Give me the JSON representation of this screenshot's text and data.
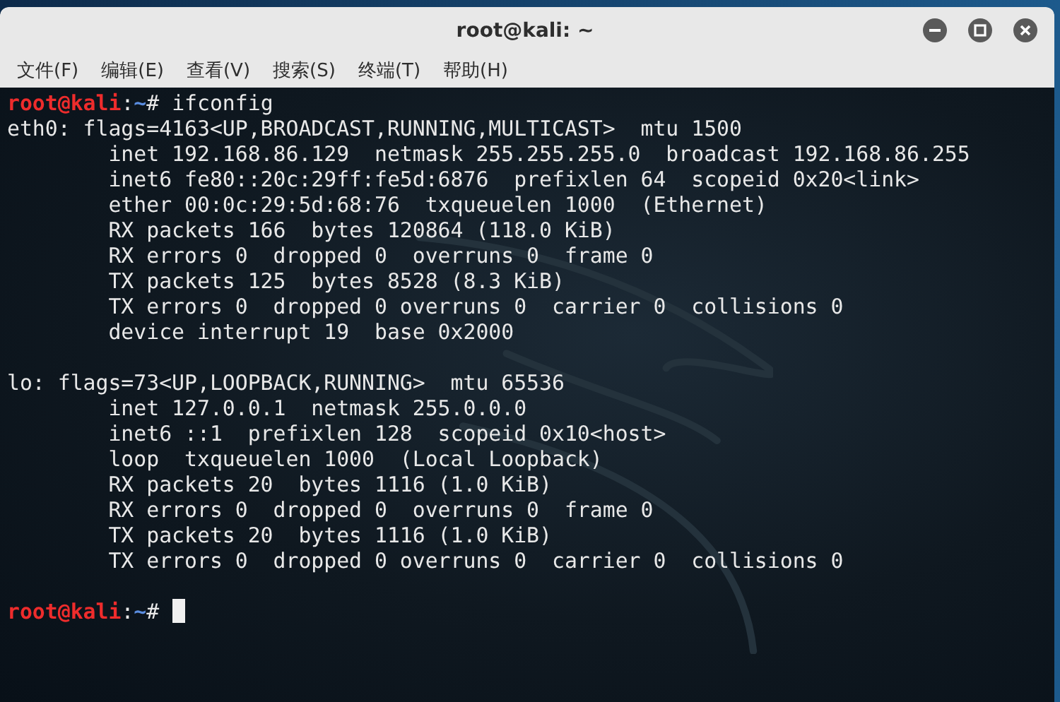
{
  "window": {
    "title": "root@kali: ~"
  },
  "menu": [
    "文件(F)",
    "编辑(E)",
    "查看(V)",
    "搜索(S)",
    "终端(T)",
    "帮助(H)"
  ],
  "terminal": {
    "lines": [
      {
        "kind": "prompt",
        "user_host": "root@kali",
        "separator": ":",
        "path": "~",
        "symbol": "#",
        "command": "ifconfig",
        "cursor": false
      },
      {
        "kind": "output",
        "text": "eth0: flags=4163<UP,BROADCAST,RUNNING,MULTICAST>  mtu 1500"
      },
      {
        "kind": "output",
        "text": "        inet 192.168.86.129  netmask 255.255.255.0  broadcast 192.168.86.255"
      },
      {
        "kind": "output",
        "text": "        inet6 fe80::20c:29ff:fe5d:6876  prefixlen 64  scopeid 0x20<link>"
      },
      {
        "kind": "output",
        "text": "        ether 00:0c:29:5d:68:76  txqueuelen 1000  (Ethernet)"
      },
      {
        "kind": "output",
        "text": "        RX packets 166  bytes 120864 (118.0 KiB)"
      },
      {
        "kind": "output",
        "text": "        RX errors 0  dropped 0  overruns 0  frame 0"
      },
      {
        "kind": "output",
        "text": "        TX packets 125  bytes 8528 (8.3 KiB)"
      },
      {
        "kind": "output",
        "text": "        TX errors 0  dropped 0 overruns 0  carrier 0  collisions 0"
      },
      {
        "kind": "output",
        "text": "        device interrupt 19  base 0x2000"
      },
      {
        "kind": "blank"
      },
      {
        "kind": "output",
        "text": "lo: flags=73<UP,LOOPBACK,RUNNING>  mtu 65536"
      },
      {
        "kind": "output",
        "text": "        inet 127.0.0.1  netmask 255.0.0.0"
      },
      {
        "kind": "output",
        "text": "        inet6 ::1  prefixlen 128  scopeid 0x10<host>"
      },
      {
        "kind": "output",
        "text": "        loop  txqueuelen 1000  (Local Loopback)"
      },
      {
        "kind": "output",
        "text": "        RX packets 20  bytes 1116 (1.0 KiB)"
      },
      {
        "kind": "output",
        "text": "        RX errors 0  dropped 0  overruns 0  frame 0"
      },
      {
        "kind": "output",
        "text": "        TX packets 20  bytes 1116 (1.0 KiB)"
      },
      {
        "kind": "output",
        "text": "        TX errors 0  dropped 0 overruns 0  carrier 0  collisions 0"
      },
      {
        "kind": "blank"
      },
      {
        "kind": "prompt",
        "user_host": "root@kali",
        "separator": ":",
        "path": "~",
        "symbol": "#",
        "cursor": true
      }
    ]
  }
}
